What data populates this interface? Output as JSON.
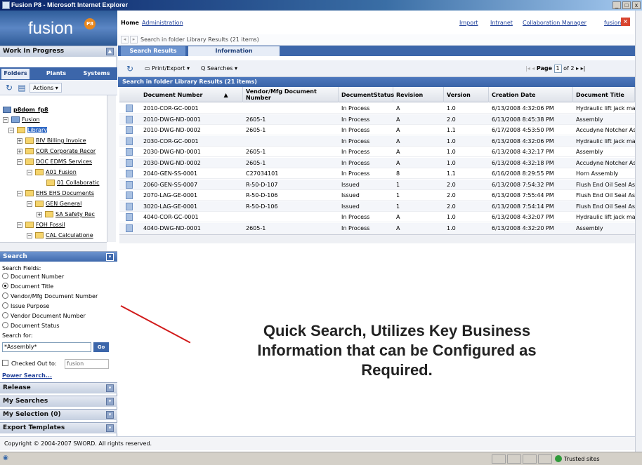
{
  "window": {
    "title": "Fusion P8 - Microsoft Internet Explorer",
    "controls": [
      "_",
      "□",
      "x"
    ]
  },
  "logo": {
    "text": "fusion",
    "badge": "P8"
  },
  "topnav": {
    "home": "Home",
    "administration": "Administration",
    "import": "Import",
    "intranet": "Intranet",
    "collaboration_manager": "Collaboration Manager",
    "user": "fusion"
  },
  "breadcrumb": "Search in folder Library Results (21 items)",
  "left": {
    "work_in_progress": "Work In Progress",
    "tabs": [
      "Folders",
      "Plants",
      "Systems"
    ],
    "actions_label": "Actions",
    "tree": [
      {
        "label": "p8dom_fp8",
        "level": 0,
        "bold": true
      },
      {
        "label": "Fusion",
        "level": 0
      },
      {
        "label": "Library",
        "level": 1,
        "selected": true
      },
      {
        "label": "BIV Billing Invoice",
        "level": 2
      },
      {
        "label": "COR Corporate Recor",
        "level": 2
      },
      {
        "label": "DOC EDMS Services",
        "level": 2
      },
      {
        "label": "A01 Fusion",
        "level": 3
      },
      {
        "label": "01 Collaboratic",
        "level": 4
      },
      {
        "label": "EHS EHS Documents",
        "level": 2
      },
      {
        "label": "GEN General",
        "level": 3
      },
      {
        "label": "SA Safety Rec",
        "level": 4
      },
      {
        "label": "FOH Fossil",
        "level": 2
      },
      {
        "label": "CAL Calculatione",
        "level": 3
      }
    ],
    "search": {
      "header": "Search",
      "fields_label": "Search Fields:",
      "options": [
        {
          "label": "Document Number",
          "selected": false
        },
        {
          "label": "Document Title",
          "selected": true
        },
        {
          "label": "Vendor/Mfg Document Number",
          "selected": false
        },
        {
          "label": "Issue Purpose",
          "selected": false
        },
        {
          "label": "Vendor Document Number",
          "selected": false
        },
        {
          "label": "Document Status",
          "selected": false
        }
      ],
      "search_for_label": "Search for:",
      "search_value": "*Assembly*",
      "go_label": "Go",
      "checked_out_label": "Checked Out to:",
      "checked_out_value": "fusion",
      "power_search": "Power Search..."
    },
    "sections": [
      "Release",
      "My Searches",
      "My Selection (0)",
      "Export Templates"
    ]
  },
  "main": {
    "tabs": [
      "Search Results",
      "Information"
    ],
    "toolbar": {
      "print_export": "Print/Export",
      "searches": "Searches"
    },
    "pager": {
      "label": "Page",
      "current": "1",
      "of": "of 2"
    },
    "results_title": "Search in folder Library Results (21 items)",
    "columns": [
      "Document Number",
      "Vendor/Mfg Document Number",
      "DocumentStatus",
      "Revision",
      "Version",
      "Creation Date",
      "Document Title"
    ],
    "rows": [
      [
        "2010-COR-GC-0001",
        "",
        "In Process",
        "A",
        "1.0",
        "6/13/2008 4:32:06 PM",
        "Hydraulic lift jack mair"
      ],
      [
        "2010-DWG-ND-0001",
        "2605-1",
        "In Process",
        "A",
        "2.0",
        "6/13/2008 8:45:38 PM",
        "Assembly"
      ],
      [
        "2010-DWG-ND-0002",
        "2605-1",
        "In Process",
        "A",
        "1.1",
        "6/17/2008 4:53:50 PM",
        "Accudyne Notcher As:"
      ],
      [
        "2030-COR-GC-0001",
        "",
        "In Process",
        "A",
        "1.0",
        "6/13/2008 4:32:06 PM",
        "Hydraulic lift jack mair"
      ],
      [
        "2030-DWG-ND-0001",
        "2605-1",
        "In Process",
        "A",
        "1.0",
        "6/13/2008 4:32:17 PM",
        "Assembly"
      ],
      [
        "2030-DWG-ND-0002",
        "2605-1",
        "In Process",
        "A",
        "1.0",
        "6/13/2008 4:32:18 PM",
        "Accudyne Notcher As:"
      ],
      [
        "2040-GEN-SS-0001",
        "C27034101",
        "In Process",
        "8",
        "1.1",
        "6/16/2008 8:29:55 PM",
        "Horn Assembly"
      ],
      [
        "2060-GEN-SS-0007",
        "R-50-D-107",
        "Issued",
        "1",
        "2.0",
        "6/13/2008 7:54:32 PM",
        "Flush End Oil Seal Ass"
      ],
      [
        "2070-LAG-GE-0001",
        "R-50-D-106",
        "Issued",
        "1",
        "2.0",
        "6/13/2008 7:55:44 PM",
        "Flush End Oil Seal Ass"
      ],
      [
        "3020-LAG-GE-0001",
        "R-50-D-106",
        "Issued",
        "1",
        "2.0",
        "6/13/2008 7:54:14 PM",
        "Flush End Oil Seal Ass"
      ],
      [
        "4040-COR-GC-0001",
        "",
        "In Process",
        "A",
        "1.0",
        "6/13/2008 4:32:07 PM",
        "Hydraulic lift jack mair"
      ],
      [
        "4040-DWG-ND-0001",
        "2605-1",
        "In Process",
        "A",
        "1.0",
        "6/13/2008 4:32:20 PM",
        "Assembly"
      ]
    ]
  },
  "annotation": {
    "line1": "Quick Search, Utilizes Key Business",
    "line2": "Information that can be Configured as",
    "line3": "Required.",
    "color": "#d11a1a"
  },
  "footer": {
    "copyright": "Copyright © 2004-2007 SWORD. All rights reserved.",
    "status": "Trusted sites"
  }
}
